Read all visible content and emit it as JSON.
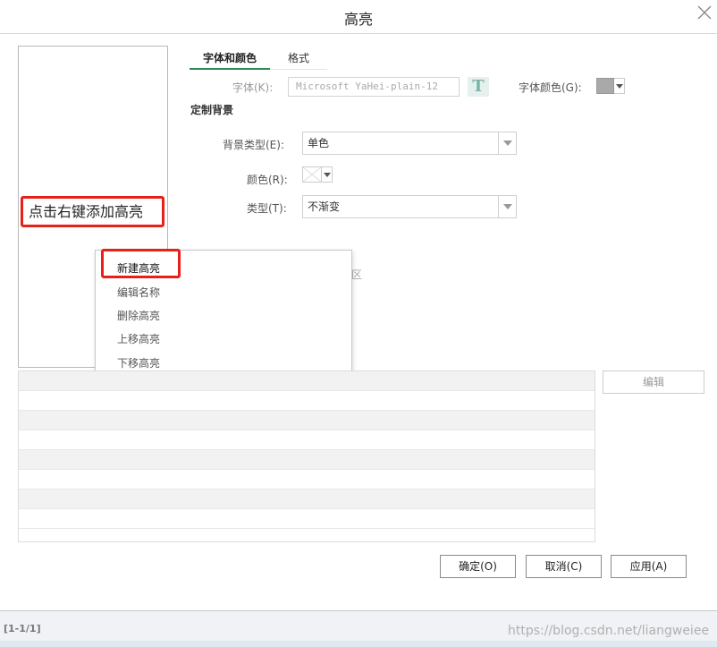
{
  "window": {
    "title": "高亮"
  },
  "left_panel": {
    "hint": "点击右键添加高亮"
  },
  "tabs": [
    {
      "label": "字体和颜色",
      "active": true
    },
    {
      "label": "格式",
      "active": false
    }
  ],
  "font_row": {
    "font_label": "字体(K):",
    "font_value": "Microsoft YaHei-plain-12",
    "font_button_glyph": "T",
    "font_color_label": "字体颜色(G):",
    "font_color": "#a9a9a9"
  },
  "custom_background": {
    "section_title": "定制背景",
    "bg_type_label": "背景类型(E):",
    "bg_type_value": "单色",
    "color_label": "颜色(R):",
    "gradient_label": "类型(T):",
    "gradient_value": "不渐变",
    "obscured_text": "区"
  },
  "context_menu": {
    "items": [
      "新建高亮",
      "编辑名称",
      "删除高亮",
      "上移高亮",
      "下移高亮"
    ]
  },
  "table": {
    "rows": 9
  },
  "edit_button": "编辑",
  "footer": {
    "ok": "确定(O)",
    "cancel": "取消(C)",
    "apply": "应用(A)"
  },
  "status": {
    "pager": "[1-1/1]",
    "watermark": "https://blog.csdn.net/liangweiee"
  },
  "colors": {
    "accent_tab": "#2e8b57",
    "highlight_border": "#e8201a"
  }
}
